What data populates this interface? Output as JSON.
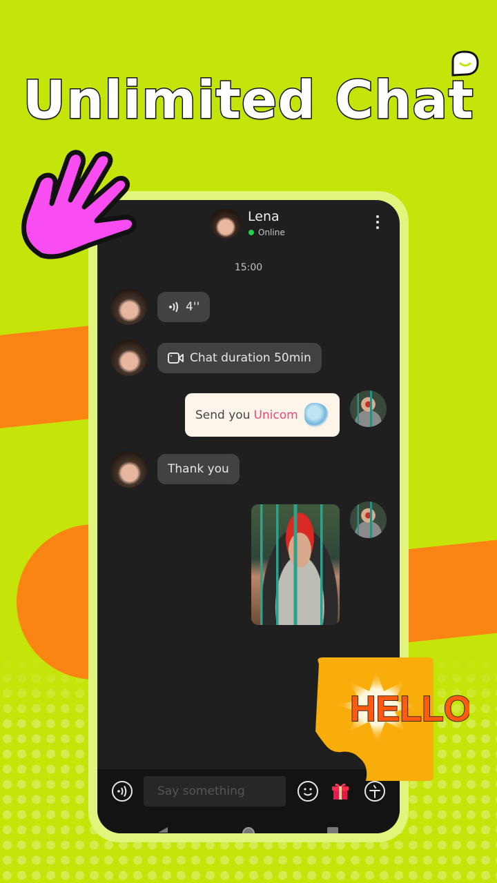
{
  "promo": {
    "headline": "Unlimited Chat",
    "hello_sticker_text": "HELLO",
    "colors": {
      "background": "#c5e40a",
      "accent_orange": "#fb8513",
      "hand_pink": "#f94df2",
      "sticker_orange": "#f9ad0b",
      "hello_text": "#ff5a10"
    }
  },
  "chat": {
    "header": {
      "back_icon": "arrow-left-icon",
      "contact_name": "Lena",
      "status": "Online",
      "status_color": "#1fd34a",
      "menu_icon": "more-vertical-icon"
    },
    "timestamp": "15:00",
    "messages": [
      {
        "sender": "Lena",
        "type": "voice",
        "icon": "voice-icon",
        "text": "4''"
      },
      {
        "sender": "Lena",
        "type": "video-call",
        "icon": "video-camera-icon",
        "text": "Chat duration 50min"
      },
      {
        "sender": "me",
        "type": "gift",
        "prefix": "Send you",
        "gift_name": "Unicom",
        "icon": "unicorn-gift-icon"
      },
      {
        "sender": "Lena",
        "type": "text",
        "text": "Thank you"
      },
      {
        "sender": "me",
        "type": "image",
        "alt": "photo of man with red headband"
      }
    ],
    "input": {
      "placeholder": "Say something",
      "value": "",
      "voice_icon": "voice-input-icon",
      "emoji_icon": "emoji-icon",
      "gift_icon": "gift-icon",
      "extra_icon": "translate-icon"
    },
    "system_nav": [
      "back",
      "home",
      "recents"
    ]
  }
}
